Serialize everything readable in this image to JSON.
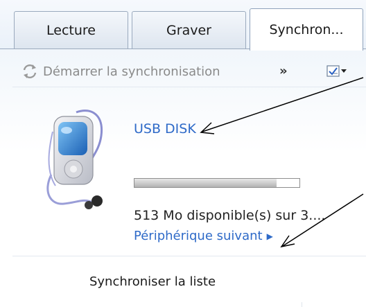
{
  "tabs": [
    {
      "label": "Lecture"
    },
    {
      "label": "Graver"
    },
    {
      "label": "Synchron..."
    }
  ],
  "toolbar": {
    "sync_label": "Démarrer la synchronisation",
    "more_label": "»"
  },
  "device": {
    "name": "USB DISK",
    "space_text": "513 Mo disponible(s) sur 3....",
    "usage_fraction": 0.86,
    "next_label": "Périphérique suivant"
  },
  "list": {
    "title": "Synchroniser la liste"
  },
  "colors": {
    "link": "#2e6ac8",
    "tab_border": "#9aa9bd"
  }
}
